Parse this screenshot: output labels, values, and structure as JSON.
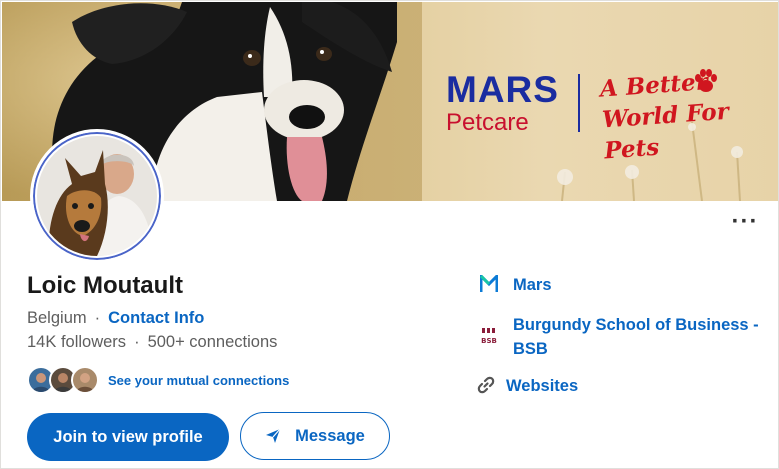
{
  "banner": {
    "brand": "MARS",
    "brand_sub": "Petcare",
    "tagline": "A Better World For Pets",
    "colors": {
      "brand_blue": "#1a2ca0",
      "brand_red": "#c8102e"
    }
  },
  "profile": {
    "name": "Loic Moutault",
    "location": "Belgium",
    "contact_info_label": "Contact Info",
    "followers": "14K followers",
    "connections": "500+ connections",
    "mutual_label": "See your mutual connections",
    "separator": "·"
  },
  "actions": {
    "join_label": "Join to view profile",
    "message_label": "Message",
    "more_label": "···"
  },
  "experience": {
    "company": "Mars",
    "school": "Burgundy School of Business - BSB",
    "school_logo_text": "BSB",
    "websites_label": "Websites"
  },
  "icons": {
    "more": "more-icon",
    "send": "send-icon",
    "link": "link-icon",
    "company_logo": "mars-logo-icon",
    "school_logo": "bsb-logo-icon"
  },
  "theme": {
    "accent": "#0a66c2",
    "text_secondary": "#5e5e5e"
  }
}
